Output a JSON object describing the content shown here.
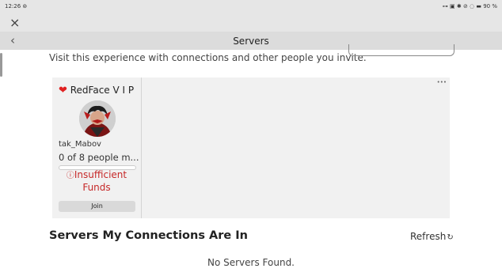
{
  "status_bar": {
    "time": "12:26 ⊚",
    "right": "⊶ ▣ ✱ ⊘ ◌ ▬ 90 %"
  },
  "nav": {
    "close_icon": "×",
    "back_icon": "‹",
    "title": "Servers"
  },
  "invite": {
    "text": "Visit this experience with connections and other people you invite."
  },
  "server_card": {
    "heart": "❤",
    "name": "RedFace V I P",
    "host": "tak_Mabov",
    "capacity_text": "0 of 8 people m...",
    "capacity_fraction": 0,
    "warning_icon": "ⓘ",
    "warning_text": "Insufficient Funds",
    "join_label": "Join",
    "more_icon": "•••"
  },
  "connections": {
    "title": "Servers My Connections Are In",
    "refresh_label": "Refresh",
    "refresh_icon": "↻",
    "empty_text": "No Servers Found."
  },
  "colors": {
    "accent_red": "#c62828",
    "heart_red": "#e02020"
  }
}
